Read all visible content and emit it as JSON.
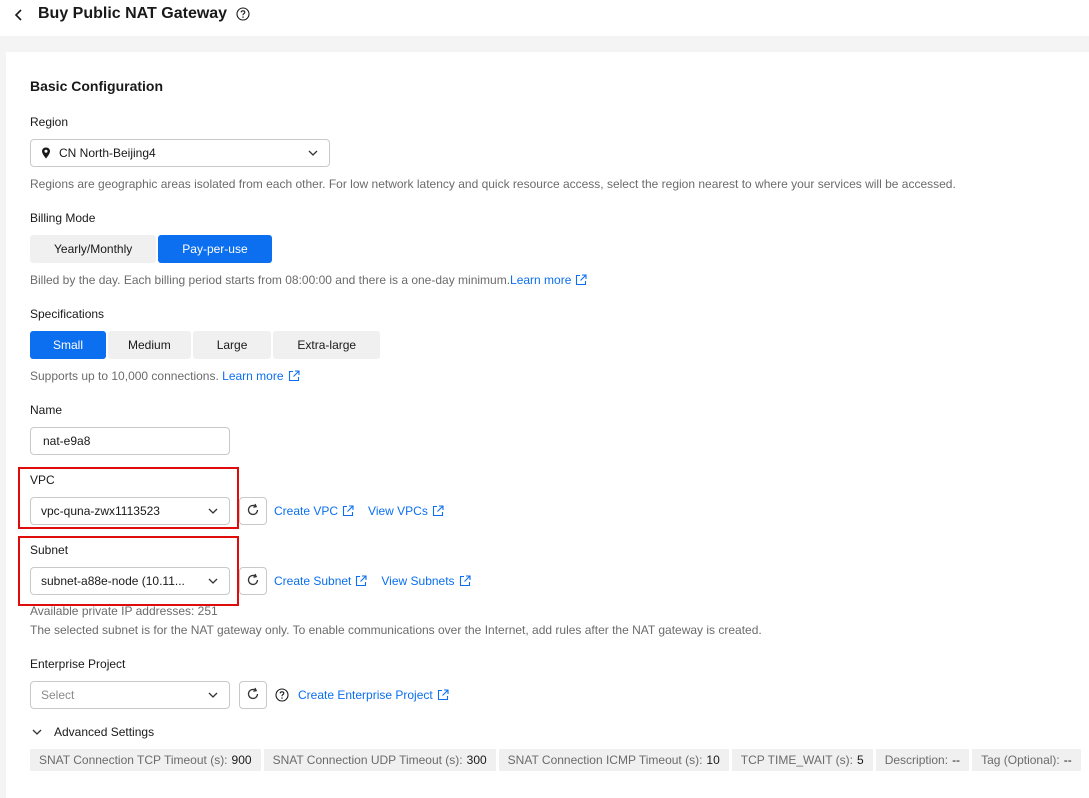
{
  "header": {
    "title": "Buy Public NAT Gateway"
  },
  "basic": {
    "title": "Basic Configuration"
  },
  "region": {
    "label": "Region",
    "value": "CN North-Beijing4",
    "hint": "Regions are geographic areas isolated from each other. For low network latency and quick resource access, select the region nearest to where your services will be accessed."
  },
  "billing": {
    "label": "Billing Mode",
    "options": [
      "Yearly/Monthly",
      "Pay-per-use"
    ],
    "selected": "Pay-per-use",
    "hint": "Billed by the day. Each billing period starts from 08:00:00 and there is a one-day minimum.",
    "learn_more": "Learn more"
  },
  "specs": {
    "label": "Specifications",
    "options": [
      "Small",
      "Medium",
      "Large",
      "Extra-large"
    ],
    "selected": "Small",
    "hint": "Supports up to 10,000 connections.",
    "learn_more": "Learn more"
  },
  "name": {
    "label": "Name",
    "value": "nat-e9a8"
  },
  "vpc": {
    "label": "VPC",
    "value": "vpc-quna-zwx1113523",
    "create_link": "Create VPC",
    "view_link": "View VPCs"
  },
  "subnet": {
    "label": "Subnet",
    "value": "subnet-a88e-node (10.11...",
    "create_link": "Create Subnet",
    "view_link": "View Subnets",
    "available": "Available private IP addresses: 251",
    "note": "The selected subnet is for the NAT gateway only. To enable communications over the Internet, add rules after the NAT gateway is created."
  },
  "enterprise": {
    "label": "Enterprise Project",
    "placeholder": "Select",
    "create_link": "Create Enterprise Project"
  },
  "advanced": {
    "label": "Advanced Settings",
    "chips": [
      {
        "key": "SNAT Connection TCP Timeout (s):",
        "value": "900"
      },
      {
        "key": "SNAT Connection UDP Timeout (s):",
        "value": "300"
      },
      {
        "key": "SNAT Connection ICMP Timeout (s):",
        "value": "10"
      },
      {
        "key": "TCP TIME_WAIT (s):",
        "value": "5"
      },
      {
        "key": "Description:",
        "value": "--"
      },
      {
        "key": "Tag (Optional):",
        "value": "--"
      }
    ]
  },
  "colors": {
    "accent": "#0b6ff0",
    "highlight": "#e00b0b"
  }
}
